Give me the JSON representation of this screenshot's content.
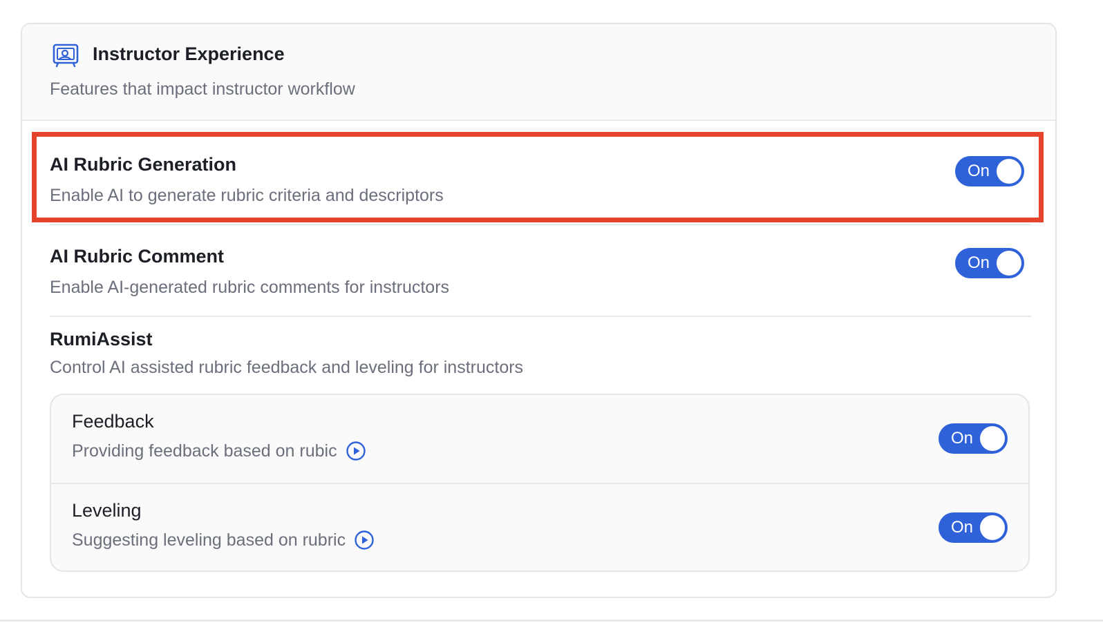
{
  "section": {
    "icon": "presentation-board-icon",
    "title": "Instructor Experience",
    "subtitle": "Features that impact instructor workflow"
  },
  "settings": [
    {
      "title": "AI Rubric Generation",
      "description": "Enable AI to generate rubric criteria and descriptors",
      "toggle": "On",
      "enabled": true,
      "highlighted": true
    },
    {
      "title": "AI Rubric Comment",
      "description": "Enable AI-generated rubric comments for instructors",
      "toggle": "On",
      "enabled": true
    }
  ],
  "rumiassist": {
    "title": "RumiAssist",
    "description": "Control AI assisted rubric feedback and leveling for instructors",
    "items": [
      {
        "title": "Feedback",
        "description": "Providing feedback based on rubic",
        "icon": "play-circle-icon",
        "toggle": "On",
        "enabled": true
      },
      {
        "title": "Leveling",
        "description": "Suggesting leveling based on rubric",
        "icon": "play-circle-icon",
        "toggle": "On",
        "enabled": true
      }
    ]
  },
  "colors": {
    "accent": "#2f62d9",
    "highlight": "#e5432a",
    "muted_text": "#6b6f7b"
  }
}
